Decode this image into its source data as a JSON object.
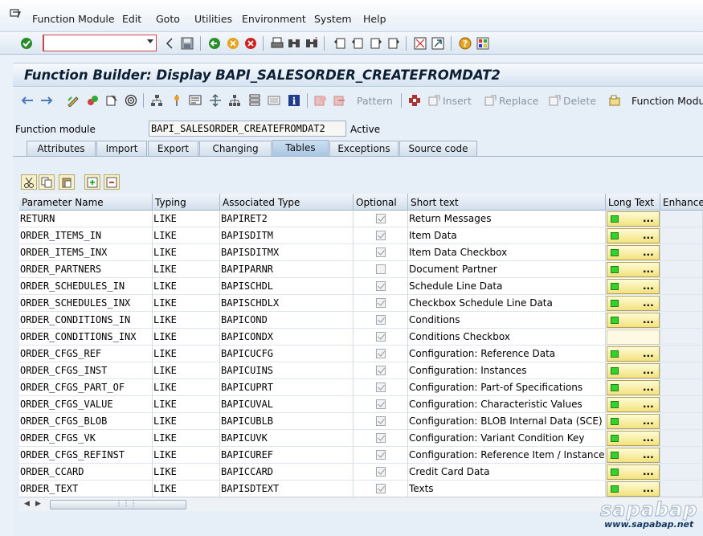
{
  "menu": {
    "items": [
      {
        "label": "Function Module"
      },
      {
        "label": "Edit"
      },
      {
        "label": "Goto"
      },
      {
        "label": "Utilities"
      },
      {
        "label": "Environment"
      },
      {
        "label": "System"
      },
      {
        "label": "Help"
      }
    ]
  },
  "command_field": {
    "value": ""
  },
  "title": "Function Builder: Display BAPI_SALESORDER_CREATEFROMDAT2",
  "app_toolbar": {
    "pattern": "Pattern",
    "insert": "Insert",
    "replace": "Replace",
    "delete": "Delete",
    "function_module": "Function Module"
  },
  "function_module": {
    "label": "Function module",
    "name": "BAPI_SALESORDER_CREATEFROMDAT2",
    "status": "Active"
  },
  "tabs": [
    {
      "label": "Attributes"
    },
    {
      "label": "Import"
    },
    {
      "label": "Export"
    },
    {
      "label": "Changing"
    },
    {
      "label": "Tables",
      "active": true
    },
    {
      "label": "Exceptions"
    },
    {
      "label": "Source code"
    }
  ],
  "table": {
    "columns": [
      "Parameter Name",
      "Typing",
      "Associated Type",
      "Optional",
      "Short text",
      "Long Text",
      "Enhancement"
    ],
    "long_text_button_label": "...",
    "rows": [
      {
        "name": "RETURN",
        "typing": "LIKE",
        "type": "BAPIRET2",
        "optional": true,
        "short_text": "Return Messages",
        "long_text": true
      },
      {
        "name": "ORDER_ITEMS_IN",
        "typing": "LIKE",
        "type": "BAPISDITM",
        "optional": true,
        "short_text": "Item Data",
        "long_text": true
      },
      {
        "name": "ORDER_ITEMS_INX",
        "typing": "LIKE",
        "type": "BAPISDITMX",
        "optional": true,
        "short_text": "Item Data Checkbox",
        "long_text": true
      },
      {
        "name": "ORDER_PARTNERS",
        "typing": "LIKE",
        "type": "BAPIPARNR",
        "optional": false,
        "short_text": "Document Partner",
        "long_text": true
      },
      {
        "name": "ORDER_SCHEDULES_IN",
        "typing": "LIKE",
        "type": "BAPISCHDL",
        "optional": true,
        "short_text": "Schedule Line Data",
        "long_text": true
      },
      {
        "name": "ORDER_SCHEDULES_INX",
        "typing": "LIKE",
        "type": "BAPISCHDLX",
        "optional": true,
        "short_text": "Checkbox Schedule Line Data",
        "long_text": true
      },
      {
        "name": "ORDER_CONDITIONS_IN",
        "typing": "LIKE",
        "type": "BAPICOND",
        "optional": true,
        "short_text": "Conditions",
        "long_text": true
      },
      {
        "name": "ORDER_CONDITIONS_INX",
        "typing": "LIKE",
        "type": "BAPICONDX",
        "optional": true,
        "short_text": "Conditions Checkbox",
        "long_text": false
      },
      {
        "name": "ORDER_CFGS_REF",
        "typing": "LIKE",
        "type": "BAPICUCFG",
        "optional": true,
        "short_text": "Configuration: Reference Data",
        "long_text": true
      },
      {
        "name": "ORDER_CFGS_INST",
        "typing": "LIKE",
        "type": "BAPICUINS",
        "optional": true,
        "short_text": "Configuration: Instances",
        "long_text": true
      },
      {
        "name": "ORDER_CFGS_PART_OF",
        "typing": "LIKE",
        "type": "BAPICUPRT",
        "optional": true,
        "short_text": "Configuration: Part-of Specifications",
        "long_text": true
      },
      {
        "name": "ORDER_CFGS_VALUE",
        "typing": "LIKE",
        "type": "BAPICUVAL",
        "optional": true,
        "short_text": "Configuration: Characteristic Values",
        "long_text": true
      },
      {
        "name": "ORDER_CFGS_BLOB",
        "typing": "LIKE",
        "type": "BAPICUBLB",
        "optional": true,
        "short_text": "Configuration: BLOB Internal Data (SCE)",
        "long_text": true
      },
      {
        "name": "ORDER_CFGS_VK",
        "typing": "LIKE",
        "type": "BAPICUVK",
        "optional": true,
        "short_text": "Configuration: Variant Condition Key",
        "long_text": true
      },
      {
        "name": "ORDER_CFGS_REFINST",
        "typing": "LIKE",
        "type": "BAPICUREF",
        "optional": true,
        "short_text": "Configuration: Reference Item / Instance",
        "long_text": true
      },
      {
        "name": "ORDER_CCARD",
        "typing": "LIKE",
        "type": "BAPICCARD",
        "optional": true,
        "short_text": "Credit Card Data",
        "long_text": true
      },
      {
        "name": "ORDER_TEXT",
        "typing": "LIKE",
        "type": "BAPISDTEXT",
        "optional": true,
        "short_text": "Texts",
        "long_text": true
      }
    ]
  },
  "watermark": {
    "logo": "sapabap",
    "url": "www.sapabap.net"
  },
  "icons": {
    "menu": "sap-menu-icon",
    "standard_toolbar": [
      "enter-icon",
      "back-icon",
      "exit-icon",
      "cancel-icon",
      "save-icon",
      "print-icon",
      "find-icon",
      "find-next-icon",
      "first-page-icon",
      "prev-page-icon",
      "next-page-icon",
      "last-page-icon",
      "new-session-icon",
      "shortcut-icon",
      "help-icon",
      "layout-icon"
    ],
    "status_led": "green-led-icon"
  },
  "colors": {
    "title": "#0e1e33",
    "led": "#32d42a",
    "long_text_button": "#f3e27e"
  }
}
